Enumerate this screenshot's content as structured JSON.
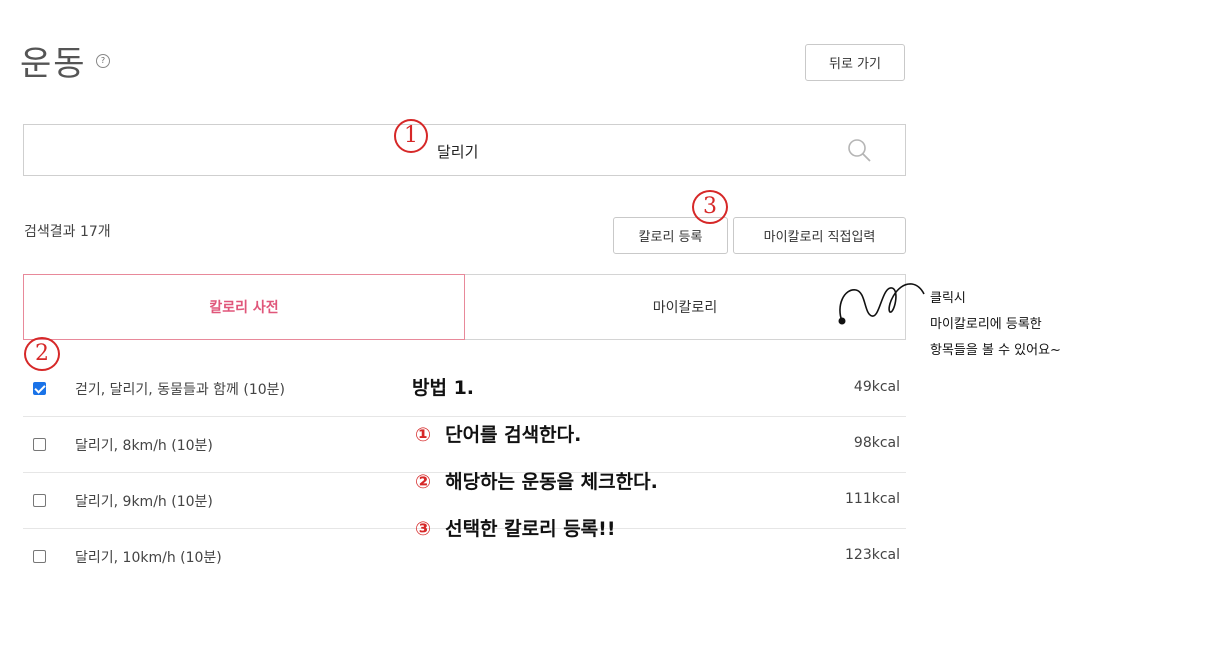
{
  "header": {
    "title": "운동",
    "help_icon": "?",
    "back_label": "뒤로 가기"
  },
  "search": {
    "value": "달리기",
    "icon": "search-icon"
  },
  "results": {
    "count_text": "검색결과 17개"
  },
  "actions": {
    "register_label": "칼로리 등록",
    "direct_input_label": "마이칼로리 직접입력"
  },
  "tabs": [
    {
      "label": "칼로리 사전",
      "active": true
    },
    {
      "label": "마이칼로리",
      "active": false
    }
  ],
  "rows": [
    {
      "name": "걷기, 달리기, 동물들과 함께  (10분)",
      "kcal": "49kcal",
      "checked": true
    },
    {
      "name": "달리기, 8km/h  (10분)",
      "kcal": "98kcal",
      "checked": false
    },
    {
      "name": "달리기, 9km/h  (10분)",
      "kcal": "111kcal",
      "checked": false
    },
    {
      "name": "달리기, 10km/h  (10분)",
      "kcal": "123kcal",
      "checked": false
    }
  ],
  "annotations": {
    "markers": [
      "1",
      "2",
      "3"
    ],
    "method_title": "방법 1.",
    "steps": [
      {
        "num": "①",
        "text": "단어를 검색한다."
      },
      {
        "num": "②",
        "text": "해당하는 운동을 체크한다."
      },
      {
        "num": "③",
        "text": "선택한 칼로리 등록!!"
      }
    ],
    "side_note": [
      "클릭시",
      "마이칼로리에 등록한",
      "항목들을 볼 수 있어요~"
    ]
  },
  "colors": {
    "accent": "#e0567a",
    "annotation": "#d62828",
    "checkbox": "#1a73e8"
  }
}
